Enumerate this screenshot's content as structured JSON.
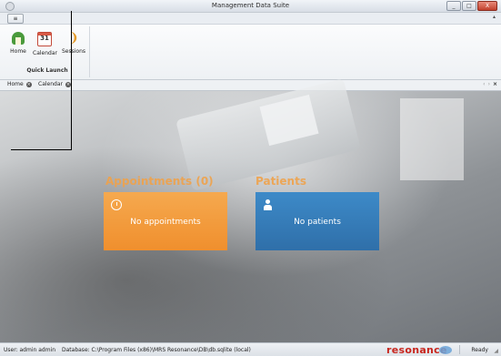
{
  "window": {
    "title": "Management Data Suite",
    "controls": [
      "_",
      "□",
      "X"
    ]
  },
  "ribbon": {
    "app_menu_label": "",
    "collapse_glyph": "▴",
    "group_label": "Quick Launch",
    "buttons": [
      {
        "label": "Home",
        "icon": "home-icon"
      },
      {
        "label": "Calendar",
        "icon": "calendar-icon",
        "icon_text": "31"
      },
      {
        "label": "Sessions",
        "icon": "ear-icon"
      }
    ]
  },
  "doctabs": {
    "tabs": [
      {
        "label": "Home"
      },
      {
        "label": "Calendar"
      }
    ],
    "nav": [
      "‹",
      "›"
    ],
    "close": "×"
  },
  "main": {
    "appointments": {
      "title": "Appointments (0)",
      "tile_text": "No appointments",
      "icon": "clock-icon",
      "color": "#f39b3b"
    },
    "patients": {
      "title": "Patients",
      "tile_text": "No patients",
      "icon": "person-icon",
      "color": "#357ebd"
    }
  },
  "statusbar": {
    "user": "User: admin admin",
    "database": "Database: C:\\Program Files (x86)\\MRS Resonance\\DB\\db.sqlite (local)",
    "brand": "resonance",
    "status": "Ready"
  }
}
